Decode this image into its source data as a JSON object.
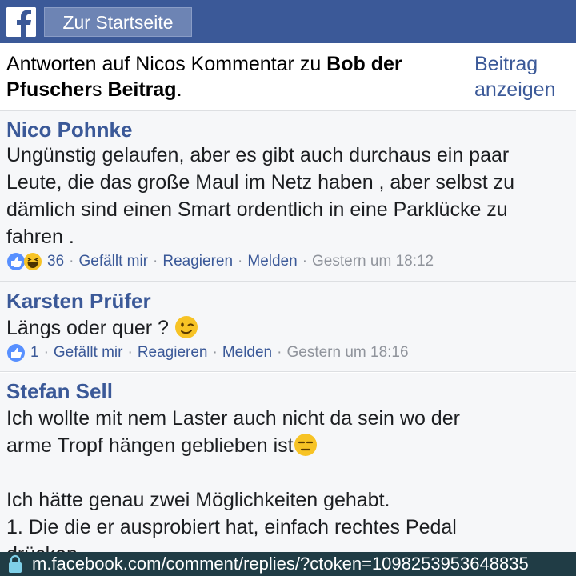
{
  "header": {
    "home_label": "Zur Startseite",
    "brand_color": "#3b5998"
  },
  "thread": {
    "prefix": "Antworten auf Nicos Kommentar zu ",
    "author_part1": "Bob der",
    "author_part2": "Pfuscher",
    "suffix_s": "s ",
    "post_word": "Beitrag",
    "period": ".",
    "view_post_link": "Beitrag anzeigen"
  },
  "comments": [
    {
      "author": "Nico Pohnke",
      "text": "Ungünstig gelaufen, aber es gibt auch durchaus ein paar Leute, die das große Maul im Netz haben , aber selbst zu dämlich sind einen Smart ordentlich in eine Parklücke zu fahren .",
      "reaction_count": "36",
      "reaction_icons": [
        "like-icon",
        "laugh-icon"
      ],
      "like": "Gefällt mir",
      "react": "Reagieren",
      "report": "Melden",
      "time": "Gestern um 18:12"
    },
    {
      "author": "Karsten Prüfer",
      "text": "Längs oder quer ?",
      "emoji": "wink-emoji",
      "reaction_count": "1",
      "reaction_icons": [
        "like-icon"
      ],
      "like": "Gefällt mir",
      "react": "Reagieren",
      "report": "Melden",
      "time": "Gestern um 18:16"
    },
    {
      "author": "Stefan Sell",
      "line1": "Ich wollte mit nem Laster auch nicht da sein wo der",
      "line2": "arme Tropf hängen geblieben ist",
      "emoji": "expressionless-emoji",
      "line3": "Ich hätte genau zwei Möglichkeiten gehabt.",
      "line4": "1. Die die er ausprobiert hat, einfach rechtes Pedal",
      "line5": "drücken"
    }
  ],
  "url_bar": {
    "url": "m.facebook.com/comment/replies/?ctoken=1098253953648835"
  }
}
